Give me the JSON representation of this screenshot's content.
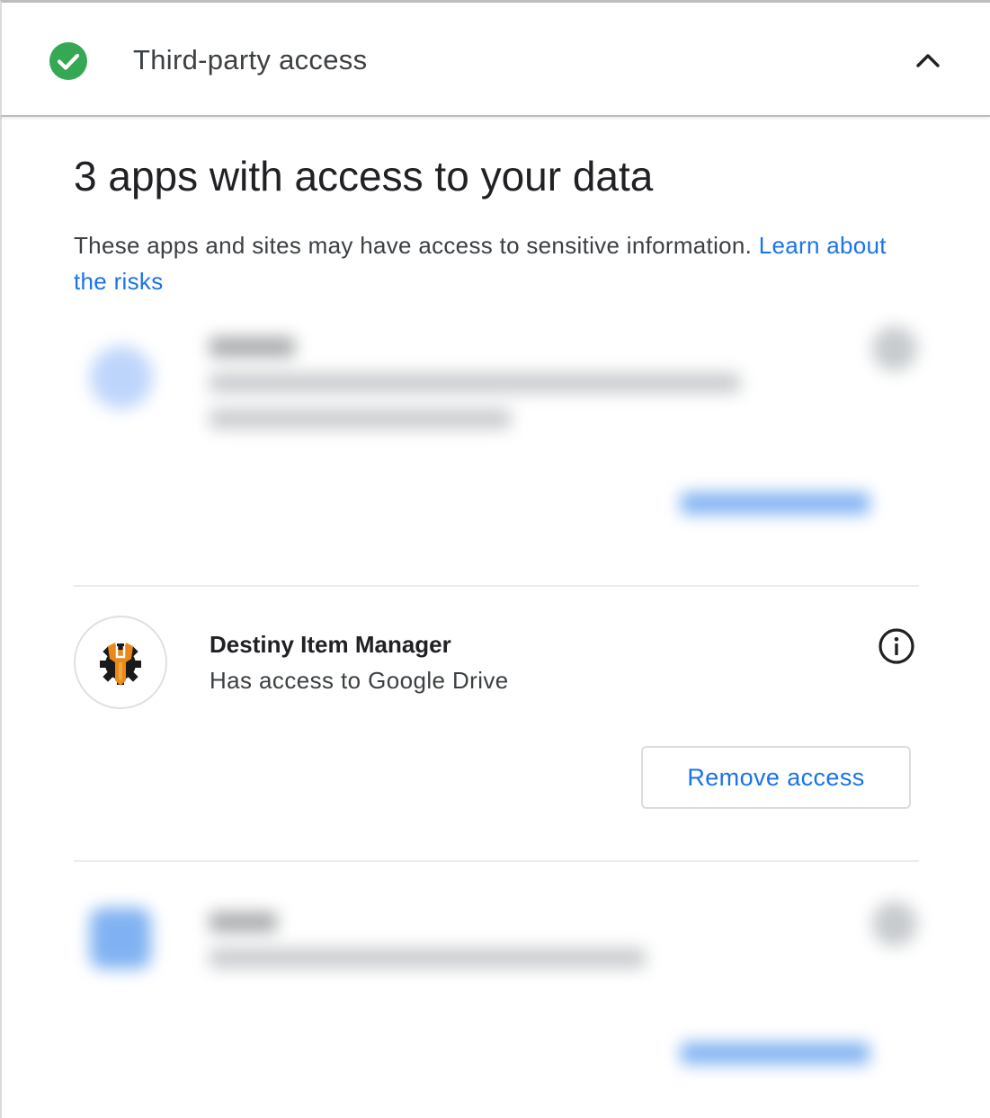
{
  "header": {
    "title": "Third-party access",
    "status_icon": "check-circle-icon",
    "status_color": "#34a853",
    "toggle_icon": "chevron-up-icon"
  },
  "section": {
    "heading": "3 apps with access to your data",
    "description": "These apps and sites may have access to sensitive information. ",
    "learn_link": "Learn about the risks"
  },
  "apps": {
    "visible": {
      "name": "Destiny Item Manager",
      "detail": "Has access to Google Drive",
      "remove_label": "Remove access",
      "info_icon": "info-icon"
    }
  },
  "colors": {
    "accent": "#1a73e8",
    "text_primary": "#202124",
    "text_secondary": "#3c4043",
    "border": "#dadce0"
  }
}
